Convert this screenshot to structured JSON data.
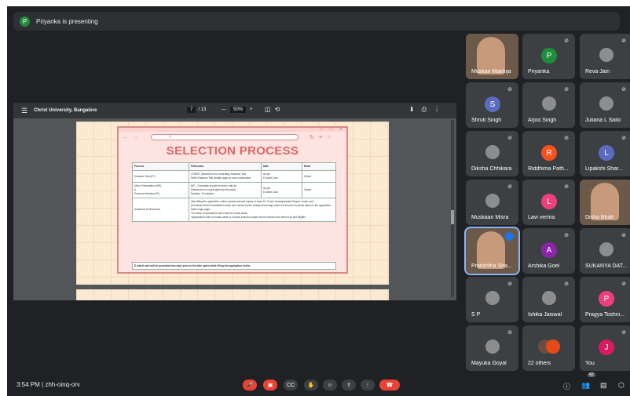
{
  "presenting": {
    "avatar": "P",
    "text": "Priyanka is presenting"
  },
  "pdf": {
    "title": "Christ University, Bangalore",
    "page": "7",
    "total": "/ 13",
    "zoom": "50%",
    "zoom_minus": "—",
    "zoom_plus": "+",
    "menu_icon": "menu-icon"
  },
  "slide": {
    "title": "SELECTION PROCESS",
    "headers": [
      "Process",
      "Particulars",
      "Date",
      "Mode"
    ],
    "rows": [
      [
        "Entrance Test (ET)",
        "CHRIST (Deemed to be University) Entrance Test\nRefer Entrance Test Details page for more information",
        "As per\nE Admit Card",
        "Online"
      ],
      [
        "Micro Presentation (MP)\n&\nPersonal Interview (PI)",
        "MP – Candidate should be able to talk for\n90seconds on a topic given by the panel\nDuration: 10 minutes",
        "As per\nE Admit Card",
        "Online"
      ],
      [
        "Academic Performance",
        "After filling the application online upload scanned copies of class 10,12 and Undergraduate Degree marks card (Semester/Year/Consolidated marks card issued by the college/university) under the document upload option in the application status login page.\nThe office of admissions will verify the marks cards.\n*Applications with no marks cards or unclear scanned copies will be rejected and termed as Not Eligible",
        "",
        ""
      ]
    ],
    "note": "E Admit card will be generated two days prior to the date opted while filling the application online."
  },
  "participants": [
    {
      "name": "Muskan Makhija",
      "type": "video"
    },
    {
      "name": "Priyanka",
      "initial": "P",
      "color": "#1e8e3e",
      "type": "avatar"
    },
    {
      "name": "Reva Jain",
      "type": "photo"
    },
    {
      "name": "Shruti Singh",
      "initial": "S",
      "color": "#5c6bc0",
      "type": "avatar"
    },
    {
      "name": "Arjoo Singh",
      "type": "photo"
    },
    {
      "name": "Juliana L Sailo",
      "type": "photo"
    },
    {
      "name": "Diksha Chhikara",
      "type": "photo"
    },
    {
      "name": "Riddhima Path...",
      "initial": "R",
      "color": "#f4511e",
      "type": "avatar"
    },
    {
      "name": "Lipakshi Shar...",
      "initial": "L",
      "color": "#5c6bc0",
      "type": "avatar"
    },
    {
      "name": "Muskaan Misra",
      "type": "photo"
    },
    {
      "name": "Lavi verma",
      "initial": "L",
      "color": "#ec407a",
      "type": "avatar"
    },
    {
      "name": "Disha Bhatt",
      "type": "video"
    },
    {
      "name": "Pratishtha Sha...",
      "type": "video"
    },
    {
      "name": "Arshika Goel",
      "initial": "A",
      "color": "#8e24aa",
      "type": "avatar"
    },
    {
      "name": "SUKANYA DAT...",
      "type": "photo"
    },
    {
      "name": "S P",
      "type": "photo"
    },
    {
      "name": "Ishika Jaiswal",
      "type": "photo"
    },
    {
      "name": "Pragya Toshni...",
      "initial": "P",
      "color": "#ec407a",
      "type": "avatar"
    },
    {
      "name": "Mayuka Goyal",
      "type": "photo"
    },
    {
      "name": "22 others",
      "type": "others"
    },
    {
      "name": "You",
      "initial": "J",
      "color": "#d81b60",
      "type": "avatar"
    }
  ],
  "footer": {
    "time": "3:54 PM",
    "separator": "|",
    "code": "zhh-oinq-orv",
    "people_count": "42"
  }
}
